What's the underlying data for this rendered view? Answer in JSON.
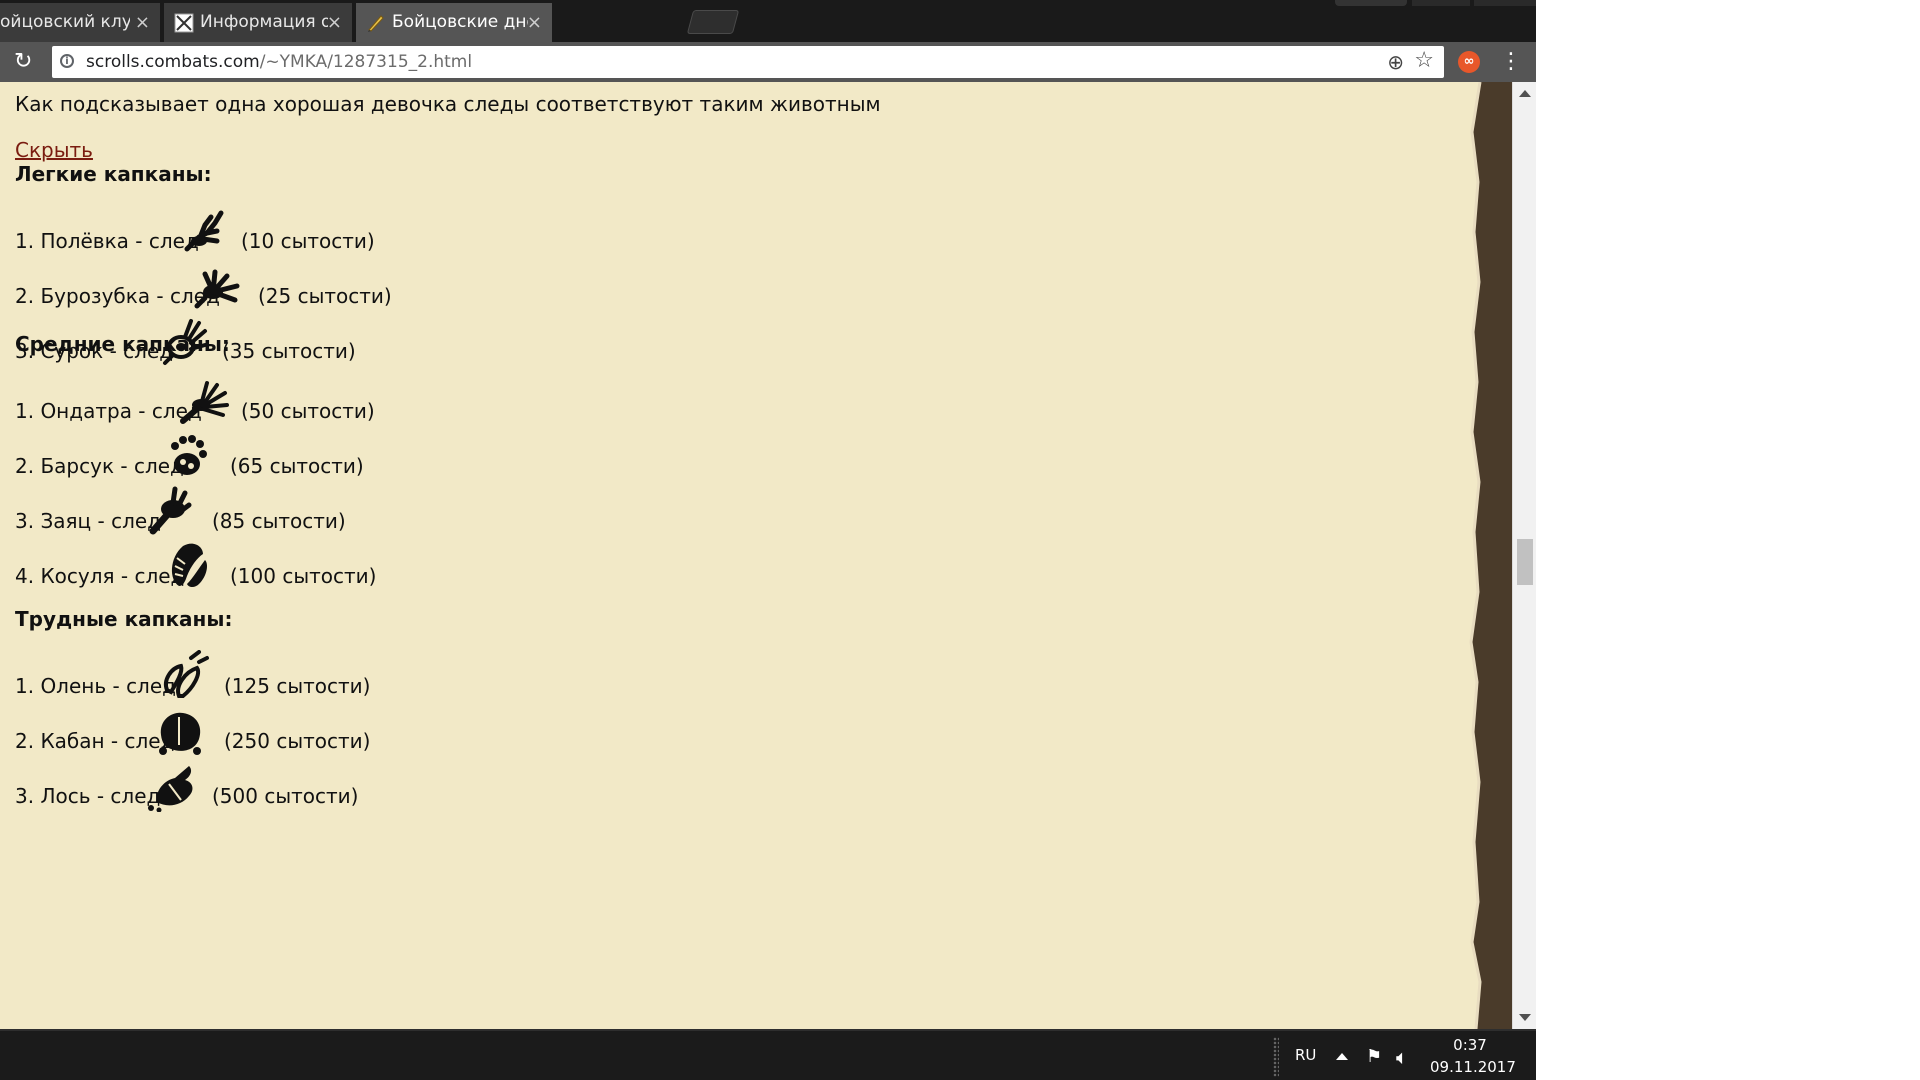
{
  "tabs": [
    {
      "title": "ойцовский клуб",
      "close": "×",
      "active": false
    },
    {
      "title": "Информация о Симаргл",
      "close": "×",
      "active": false
    },
    {
      "title": "Бойцовские дневники –",
      "close": "×",
      "active": true
    }
  ],
  "toolbar": {
    "reload_icon": "reload-icon",
    "url_host": "scrolls.combats.com",
    "url_path": "/~YMKA/1287315_2.html"
  },
  "page": {
    "intro": "Как подсказывает одна хорошая девочка следы соответствуют таким животным",
    "hide_link": "Скрыть",
    "sections": [
      {
        "title": "Легкие капканы:",
        "entries": [
          {
            "label": "1. Полёвка - след",
            "satiety": "(10 сытости)",
            "track_icon": "vole-track-icon"
          },
          {
            "label": "2. Бурозубка - след",
            "satiety": "(25 сытости)",
            "track_icon": "shrew-track-icon"
          },
          {
            "label": "3. Сурок - след",
            "satiety": "(35 сытости)",
            "track_icon": "marmot-track-icon"
          }
        ]
      },
      {
        "title": "Средние капканы:",
        "entries": [
          {
            "label": "1. Ондатра - след",
            "satiety": "(50 сытости)",
            "track_icon": "muskrat-track-icon"
          },
          {
            "label": "2. Барсук - след",
            "satiety": "(65 сытости)",
            "track_icon": "badger-track-icon"
          },
          {
            "label": "3. Заяц - след",
            "satiety": "(85 сытости)",
            "track_icon": "hare-track-icon"
          },
          {
            "label": "4. Косуля - след",
            "satiety": "(100 сытости)",
            "track_icon": "roe-deer-track-icon"
          }
        ]
      },
      {
        "title": "Трудные капканы:",
        "entries": [
          {
            "label": "1. Олень - след",
            "satiety": "(125 сытости)",
            "track_icon": "deer-track-icon"
          },
          {
            "label": "2. Кабан - след",
            "satiety": "(250 сытости)",
            "track_icon": "boar-track-icon"
          },
          {
            "label": "3. Лось - след",
            "satiety": "(500 сытости)",
            "track_icon": "moose-track-icon"
          }
        ]
      }
    ]
  },
  "taskbar": {
    "language": "RU",
    "time": "0:37",
    "date": "09.11.2017"
  },
  "colors": {
    "page_background": "#f2e9c7",
    "link": "#7a1c10",
    "torn_edge": "#4a3b2a"
  }
}
